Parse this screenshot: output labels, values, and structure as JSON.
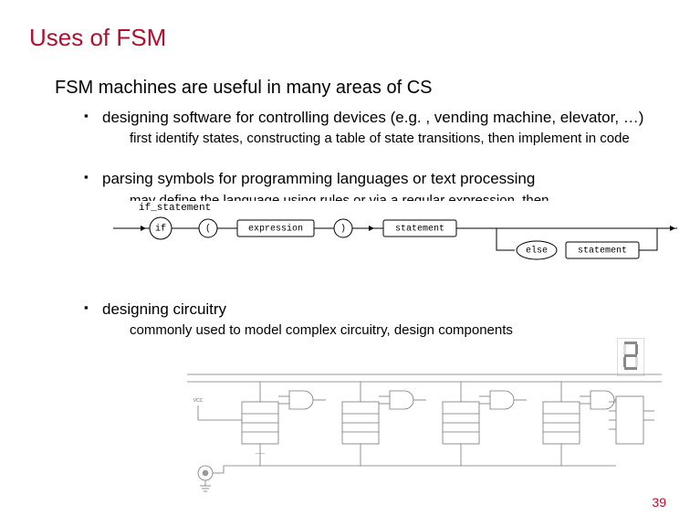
{
  "title": "Uses of FSM",
  "subtitle": "FSM machines are useful in many areas of CS",
  "bullets": {
    "b1": "designing software for controlling devices (e.g. , vending machine, elevator, …)",
    "b1_sub": "first identify states, constructing a table of state transitions, then implement in code",
    "b2": "parsing symbols for programming languages or text processing",
    "b2_sub": "may define the language using rules or via a regular expression, then",
    "b3": "designing circuitry",
    "b3_sub": "commonly used to model complex circuitry, design components"
  },
  "railroad": {
    "label": "if_statement",
    "nodes": {
      "if": "if",
      "lpar": "(",
      "expr": "expression",
      "rpar": ")",
      "stmt": "statement",
      "else": "else",
      "stmt2": "statement"
    }
  },
  "page_number": "39"
}
